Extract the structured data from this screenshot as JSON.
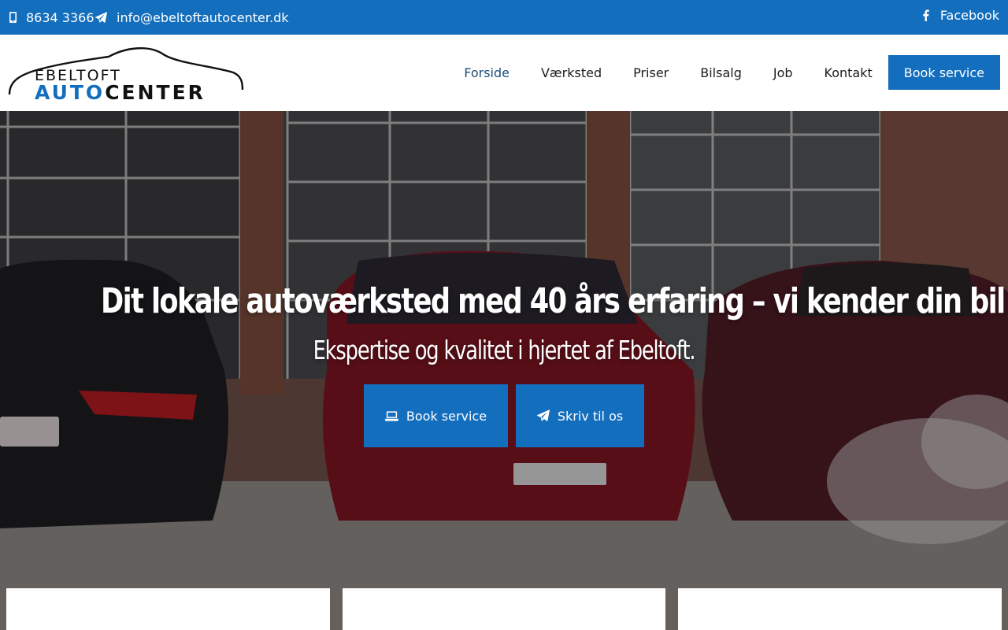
{
  "topbar": {
    "phone": "8634 3366",
    "email": "info@ebeltoftautocenter.dk",
    "facebook": "Facebook",
    "icons": [
      "mobile-icon",
      "paper-plane-icon",
      "facebook-icon"
    ]
  },
  "logo": {
    "line1": "EBELTOFT",
    "line2_a": "AUTO",
    "line2_b": "CENTER"
  },
  "nav": {
    "items": [
      "Forside",
      "Værksted",
      "Priser",
      "Bilsalg",
      "Job",
      "Kontakt"
    ],
    "active": "Forside",
    "book_label": "Book service"
  },
  "hero": {
    "title": "Dit lokale autoværksted med 40 års erfaring – vi kender din bil",
    "subtitle": "Ekspertise og kvalitet i hjertet af Ebeltoft.",
    "cta_book": "Book service",
    "cta_write": "Skriv til os"
  },
  "colors": {
    "primary": "#136ebd",
    "nav_active": "#1b4f7a",
    "text": "#1c1c1c"
  }
}
